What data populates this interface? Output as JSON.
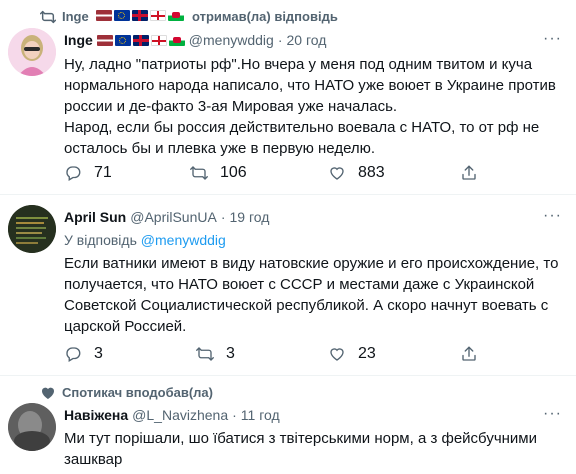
{
  "tweet1": {
    "context": "Inge",
    "context_suffix": "отримав(ла) відповідь",
    "name": "Inge",
    "handle": "@menywddig",
    "time": "20 год",
    "text": "Ну, ладно \"патриоты рф\".Но вчера у меня под одним твитом и куча нормального народа написало, что НАТО уже воюет в Украине против россии и де-факто 3-ая Мировая уже началась.\nНарод, если бы россия действительно воевала с НАТО, то от рф не осталось бы и плевка уже в первую неделю.",
    "replies": "71",
    "retweets": "106",
    "likes": "883"
  },
  "tweet2": {
    "name": "April Sun",
    "handle": "@AprilSunUA",
    "time": "19 год",
    "reply_prefix": "У відповідь",
    "reply_handle": "@menywddig",
    "text": "Если ватники имеют в виду натовские оружие и его происхождение, то получается, что НАТО воюет с СССР и местами даже с Украинской Советской Социалистической республикой. А скоро начнут воевать с царской Россией.",
    "replies": "3",
    "retweets": "3",
    "likes": "23"
  },
  "tweet3": {
    "context": "Спотикач вподобав(ла)",
    "name": "Навіжена",
    "handle": "@L_Navizhena",
    "time": "11 год",
    "text": "Ми тут порішали, шо їбатися з твітерськими норм, а з фейсбучними зашквар"
  },
  "ui": {
    "dot": "·",
    "more": "···"
  },
  "colors": {
    "text_primary": "#0f1419",
    "text_secondary": "#536471",
    "link": "#1d9bf0",
    "divider": "#eff3f4"
  },
  "icons": [
    "retweet-icon",
    "heart-icon",
    "reply-icon",
    "retweet-action-icon",
    "like-icon",
    "share-icon",
    "more-icon"
  ]
}
